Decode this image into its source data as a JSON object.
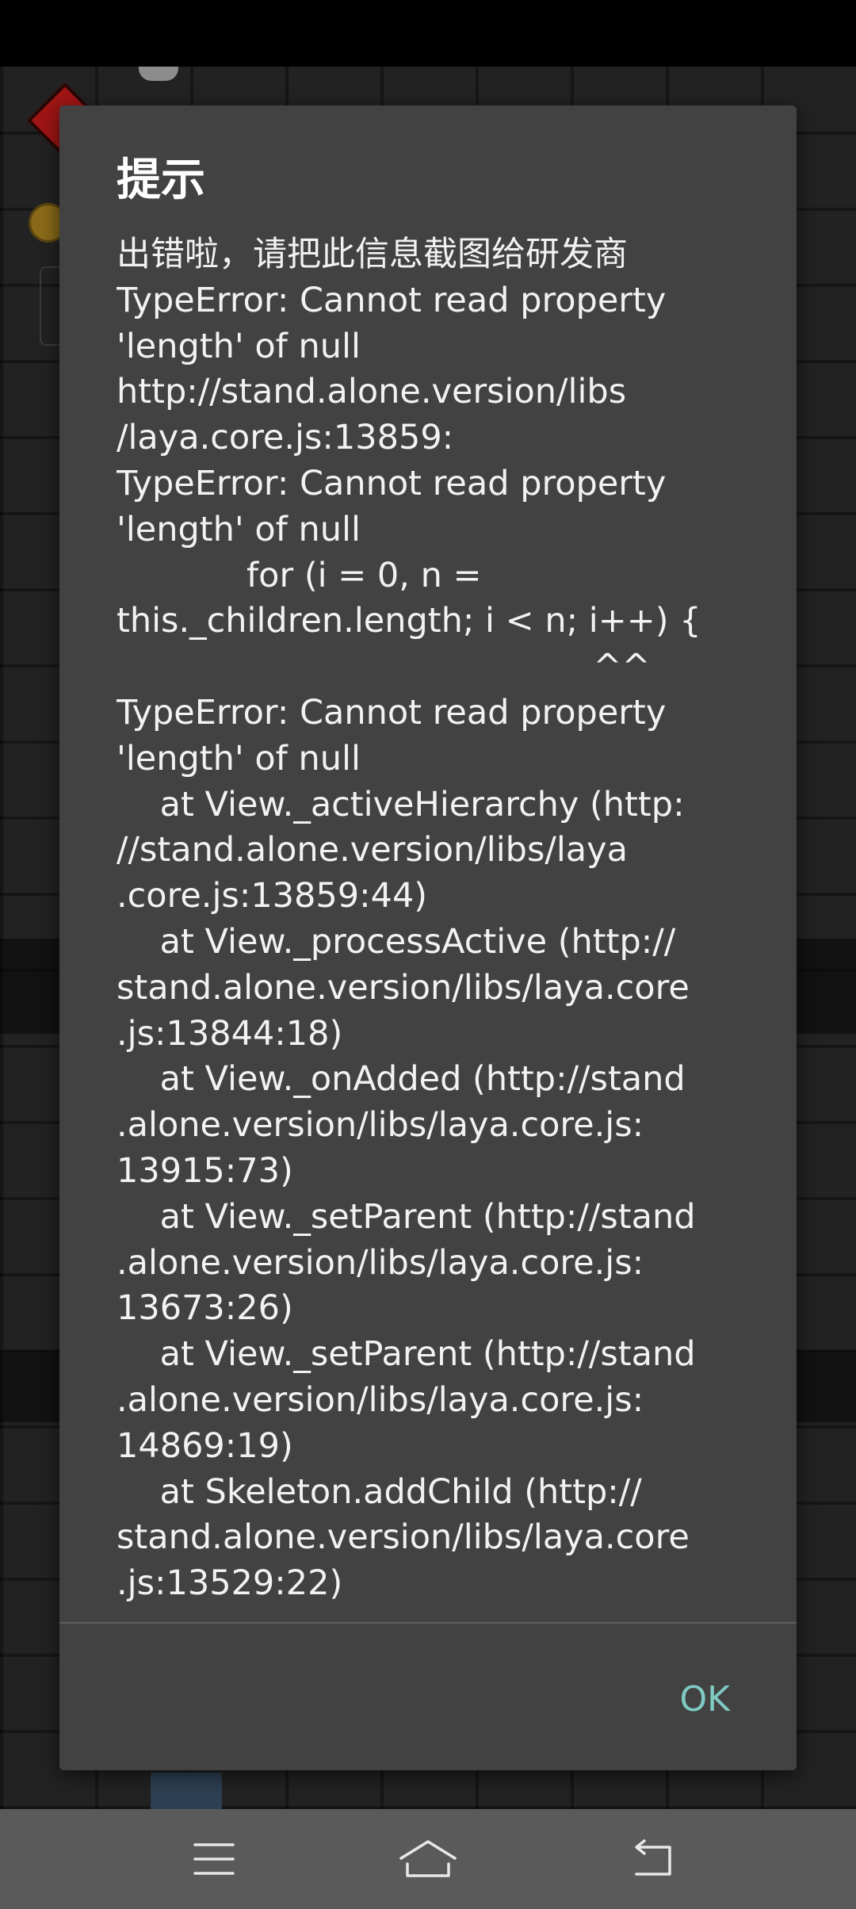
{
  "dialog": {
    "title": "提示",
    "message_lines": [
      "出错啦，请把此信息截图给研发商",
      "TypeError: Cannot read property",
      "'length' of null",
      "http://stand.alone.version/libs",
      "/laya.core.js:13859:",
      "TypeError: Cannot read property",
      "'length' of null",
      "            for (i = 0, n =",
      "this._children.length; i < n; i++) {",
      "                                            ^^",
      "TypeError: Cannot read property",
      "'length' of null",
      "    at View._activeHierarchy (http:",
      "//stand.alone.version/libs/laya",
      ".core.js:13859:44)",
      "    at View._processActive (http://",
      "stand.alone.version/libs/laya.core",
      ".js:13844:18)",
      "    at View._onAdded (http://stand",
      ".alone.version/libs/laya.core.js:",
      "13915:73)",
      "    at View._setParent (http://stand",
      ".alone.version/libs/laya.core.js:",
      "13673:26)",
      "    at View._setParent (http://stand",
      ".alone.version/libs/laya.core.js:",
      "14869:19)",
      "    at Skeleton.addChild (http://",
      "stand.alone.version/libs/laya.core",
      ".js:13529:22)"
    ],
    "ok_label": "OK"
  },
  "nav_bar": {
    "icons": [
      "menu-icon",
      "home-icon",
      "back-icon"
    ]
  },
  "colors": {
    "dialog_bg": "#424242",
    "accent": "#7fcbc4",
    "nav_bg": "#5a5a5a",
    "text": "#f2f2f2"
  }
}
